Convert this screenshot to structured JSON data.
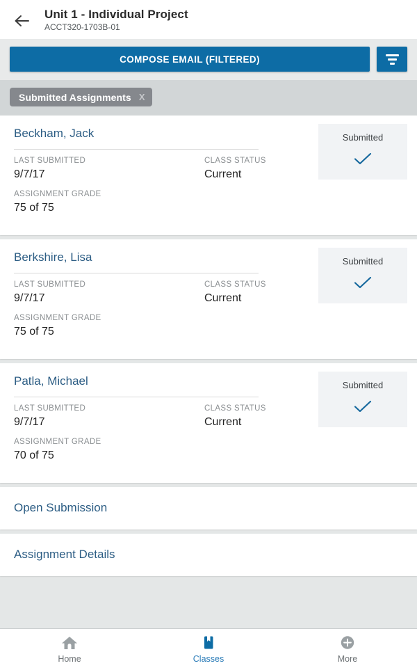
{
  "header": {
    "back_icon": "back-arrow-icon",
    "title": "Unit 1 - Individual Project",
    "subtitle": "ACCT320-1703B-01"
  },
  "toolbar": {
    "compose_label": "COMPOSE EMAIL (FILTERED)",
    "filter_icon": "filter-funnel-icon",
    "accent_color": "#0d6ca5"
  },
  "filter_chips": [
    {
      "label": "Submitted Assignments",
      "remove_label": "X"
    }
  ],
  "students": [
    {
      "name": "Beckham, Jack",
      "last_submitted_label": "LAST SUBMITTED",
      "last_submitted_value": "9/7/17",
      "class_status_label": "CLASS STATUS",
      "class_status_value": "Current",
      "assignment_grade_label": "ASSIGNMENT GRADE",
      "assignment_grade_value": "75 of 75",
      "status_text": "Submitted",
      "status_icon": "checkmark-icon"
    },
    {
      "name": "Berkshire, Lisa",
      "last_submitted_label": "LAST SUBMITTED",
      "last_submitted_value": "9/7/17",
      "class_status_label": "CLASS STATUS",
      "class_status_value": "Current",
      "assignment_grade_label": "ASSIGNMENT GRADE",
      "assignment_grade_value": "75 of 75",
      "status_text": "Submitted",
      "status_icon": "checkmark-icon"
    },
    {
      "name": "Patla, Michael",
      "last_submitted_label": "LAST SUBMITTED",
      "last_submitted_value": "9/7/17",
      "class_status_label": "CLASS STATUS",
      "class_status_value": "Current",
      "assignment_grade_label": "ASSIGNMENT GRADE",
      "assignment_grade_value": "70 of 75",
      "status_text": "Submitted",
      "status_icon": "checkmark-icon"
    }
  ],
  "links": [
    {
      "label": "Open Submission"
    },
    {
      "label": "Assignment Details"
    }
  ],
  "bottom_nav": {
    "items": [
      {
        "label": "Home",
        "icon": "home-icon",
        "active": false
      },
      {
        "label": "Classes",
        "icon": "book-bookmark-icon",
        "active": true
      },
      {
        "label": "More",
        "icon": "plus-circle-icon",
        "active": false
      }
    ],
    "active_color": "#2b7cb8",
    "inactive_color": "#9aa0a3"
  }
}
